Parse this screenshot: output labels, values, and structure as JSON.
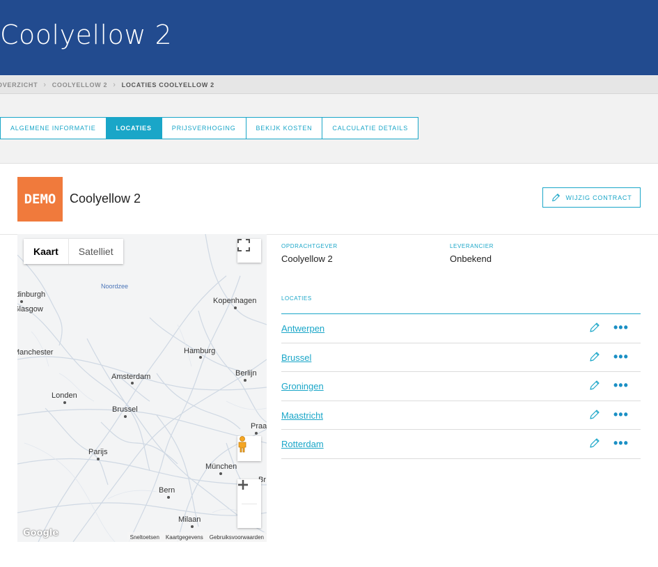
{
  "header": {
    "title": "Coolyellow 2"
  },
  "breadcrumb": {
    "items": [
      "OVERZICHT",
      "COOLYELLOW 2",
      "LOCATIES COOLYELLOW 2"
    ]
  },
  "tabs": [
    {
      "label": "ALGEMENE INFORMATIE",
      "active": false
    },
    {
      "label": "LOCATIES",
      "active": true
    },
    {
      "label": "PRIJSVERHOGING",
      "active": false
    },
    {
      "label": "BEKIJK KOSTEN",
      "active": false
    },
    {
      "label": "CALCULATIE DETAILS",
      "active": false
    }
  ],
  "card": {
    "logo_text": "DEMO",
    "title": "Coolyellow 2",
    "edit_label": "WIJZIG CONTRACT"
  },
  "map": {
    "type_map": "Kaart",
    "type_satellite": "Satelliet",
    "sea_label": "Noordzee",
    "cities": [
      "Edinburgh",
      "Glasgow",
      "Kopenhagen",
      "Manchester",
      "Hamburg",
      "Amsterdam",
      "Berlijn",
      "Londen",
      "Brussel",
      "Praag",
      "Parijs",
      "München",
      "Bern",
      "Milaan",
      "Br"
    ],
    "google_label": "Google",
    "attribution": [
      "Sneltoetsen",
      "Kaartgegevens",
      "Gebruiksvoorwaarden"
    ]
  },
  "info": {
    "client_label": "OPDRACHTGEVER",
    "client_value": "Coolyellow 2",
    "supplier_label": "LEVERANCIER",
    "supplier_value": "Onbekend",
    "locations_label": "LOCATIES"
  },
  "locations": [
    "Antwerpen",
    "Brussel",
    "Groningen",
    "Maastricht",
    "Rotterdam"
  ],
  "colors": {
    "header": "#224b8f",
    "accent": "#1aa6c8",
    "demo_logo": "#f07a3c"
  }
}
